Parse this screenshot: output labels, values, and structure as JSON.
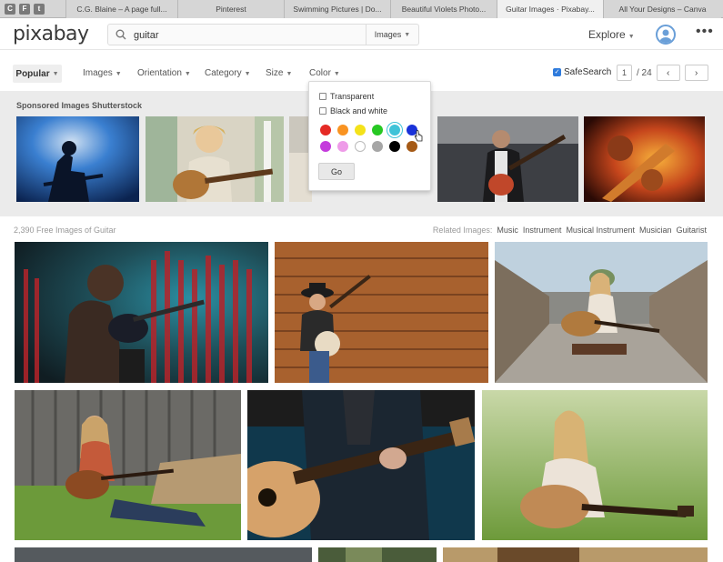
{
  "browser": {
    "tab_icons": [
      "C",
      "F",
      "t"
    ],
    "tabs": [
      {
        "label": "C.G. Blaine – A page full...",
        "active": false
      },
      {
        "label": "Pinterest",
        "active": false
      },
      {
        "label": "Swimming Pictures | Do...",
        "active": false
      },
      {
        "label": "Beautiful Violets Photo...",
        "active": false
      },
      {
        "label": "Guitar Images · Pixabay...",
        "active": true
      },
      {
        "label": "All Your Designs – Canva",
        "active": false
      }
    ]
  },
  "header": {
    "logo": "pixabay",
    "search_value": "guitar",
    "search_type": "Images",
    "explore": "Explore",
    "more": "⋮"
  },
  "filters": {
    "popular": "Popular",
    "items": [
      "Images",
      "Orientation",
      "Category",
      "Size",
      "Color"
    ],
    "safesearch": "SafeSearch",
    "page": "1",
    "page_total": "/ 24",
    "prev": "‹",
    "next": "›"
  },
  "color_dropdown": {
    "transparent": "Transparent",
    "black_white": "Black and white",
    "colors": [
      "#e52a25",
      "#f99321",
      "#f4e21a",
      "#27c823",
      "#3fc3d8",
      "#1932d9",
      "#c43bdc",
      "#ee9be8",
      "#ffffff",
      "#a6a6a6",
      "#000000",
      "#a55a16"
    ],
    "go": "Go"
  },
  "sponsored": {
    "title": "Sponsored Images Shutterstock"
  },
  "results": {
    "count": "2,390 Free Images of Guitar",
    "related_label": "Related Images:",
    "related": [
      "Music",
      "Instrument",
      "Musical Instrument",
      "Musician",
      "Guitarist"
    ]
  },
  "colors": {
    "accent": "#2f7bdc",
    "sponsored_bg": "#ebebeb"
  }
}
